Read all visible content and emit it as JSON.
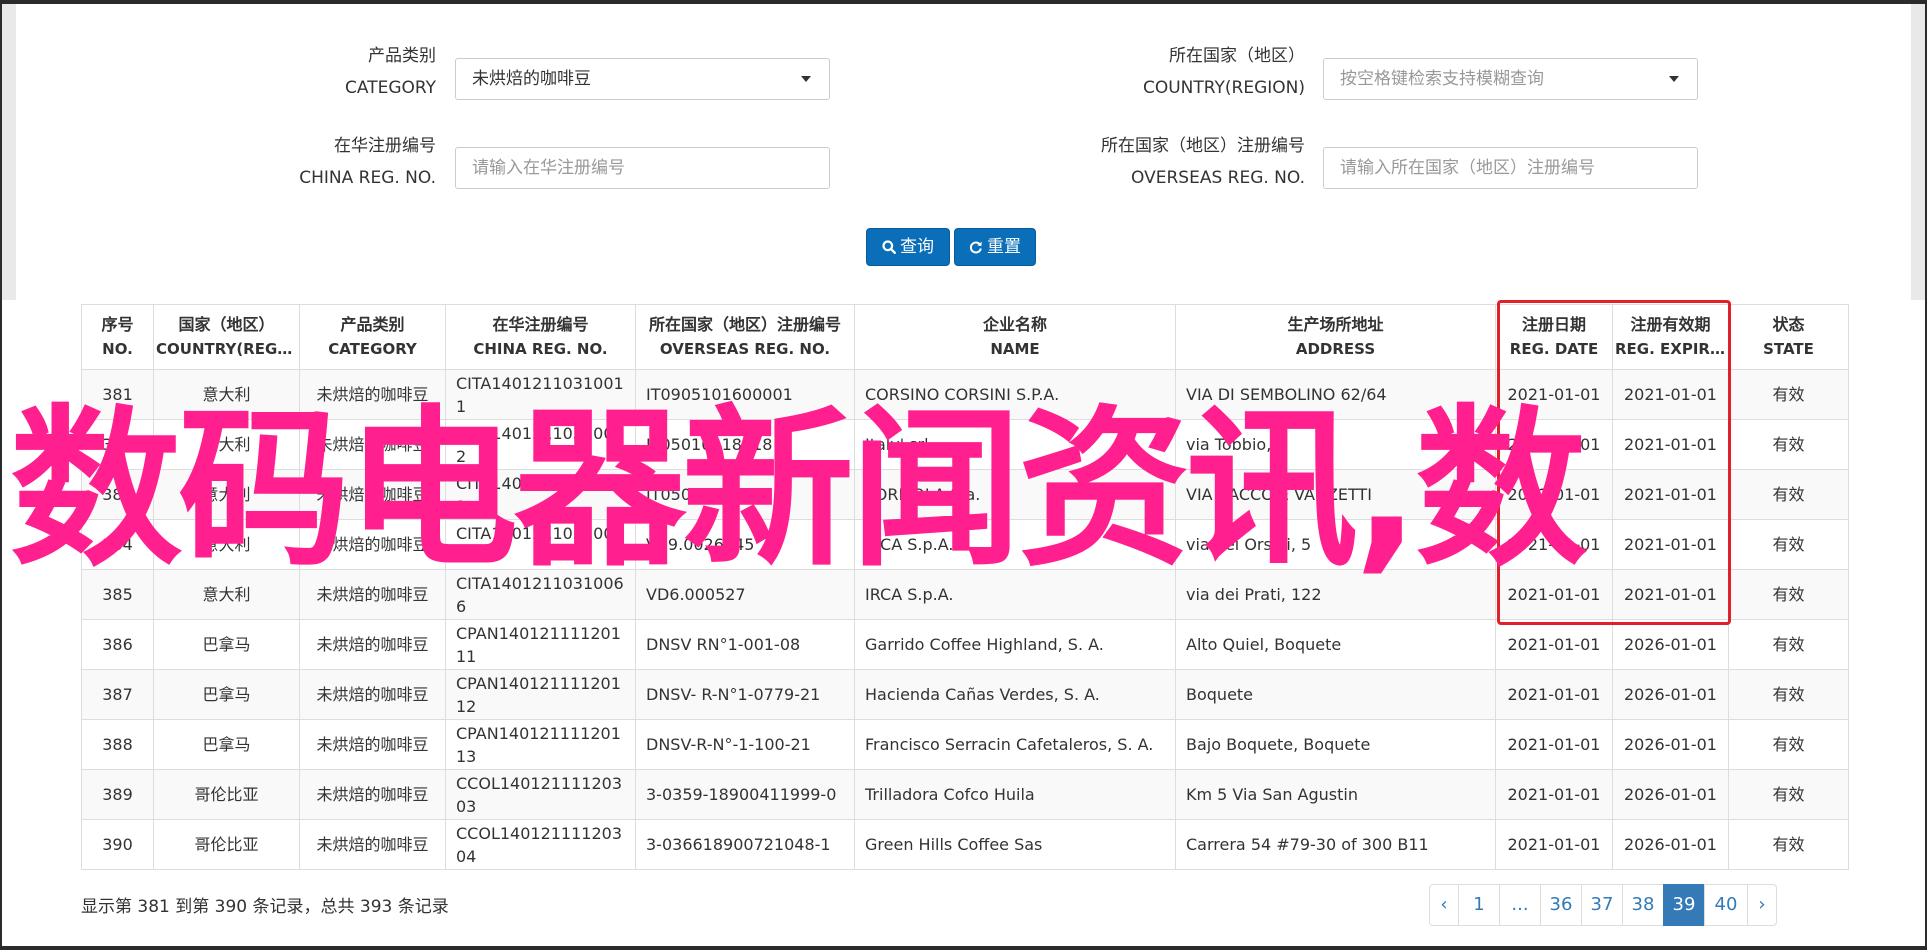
{
  "form": {
    "category_label_cn": "产品类别",
    "category_label_en": "CATEGORY",
    "category_value": "未烘焙的咖啡豆",
    "country_label_cn": "所在国家（地区）",
    "country_label_en": "COUNTRY(REGION)",
    "country_placeholder": "按空格键检索支持模糊查询",
    "china_reg_label_cn": "在华注册编号",
    "china_reg_label_en": "CHINA REG. NO.",
    "china_reg_placeholder": "请输入在华注册编号",
    "overseas_reg_label_cn": "所在国家（地区）注册编号",
    "overseas_reg_label_en": "OVERSEAS REG. NO.",
    "overseas_reg_placeholder": "请输入所在国家（地区）注册编号",
    "search_button": "查询",
    "reset_button": "重置"
  },
  "table": {
    "headers": [
      {
        "cn": "序号",
        "en": "NO."
      },
      {
        "cn": "国家（地区）",
        "en": "COUNTRY(REGIO…"
      },
      {
        "cn": "产品类别",
        "en": "CATEGORY"
      },
      {
        "cn": "在华注册编号",
        "en": "CHINA REG. NO."
      },
      {
        "cn": "所在国家（地区）注册编号",
        "en": "OVERSEAS REG. NO."
      },
      {
        "cn": "企业名称",
        "en": "NAME"
      },
      {
        "cn": "生产场所地址",
        "en": "ADDRESS"
      },
      {
        "cn": "注册日期",
        "en": "REG. DATE"
      },
      {
        "cn": "注册有效期",
        "en": "REG. EXPIRE …"
      },
      {
        "cn": "状态",
        "en": "STATE"
      }
    ],
    "rows": [
      [
        "381",
        "意大利",
        "未烘焙的咖啡豆",
        "CITA14012110310011",
        "IT0905101600001",
        "CORSINO CORSINI S.P.A.",
        "VIA DI SEMBOLINO 62/64",
        "2021-01-01",
        "2021-01-01",
        "有效"
      ],
      [
        "382",
        "意大利",
        "未烘焙的咖啡豆",
        "CITA14012110310022",
        "IT05010118718",
        "Italy' srl",
        "via Tobbio, 1",
        "2021-01-01",
        "2021-01-01",
        "有效"
      ],
      [
        "383",
        "意大利",
        "未烘焙的咖啡豆",
        "CITA14012110310033",
        "IT05019/2003",
        "TORMOLA S.a.",
        "VIA SACCO E VANZETTI",
        "2021-01-01",
        "2021-01-01",
        "有效"
      ],
      [
        "384",
        "意大利",
        "未烘焙的咖啡豆",
        "CITA14012110310044",
        "VB9.0026945",
        "IRCA S.p.A.",
        "via dei Orsini, 5",
        "2021-01-01",
        "2021-01-01",
        "有效"
      ],
      [
        "385",
        "意大利",
        "未烘焙的咖啡豆",
        "CITA14012110310066",
        "VD6.000527",
        "IRCA S.p.A.",
        "via dei Prati, 122",
        "2021-01-01",
        "2021-01-01",
        "有效"
      ],
      [
        "386",
        "巴拿马",
        "未烘焙的咖啡豆",
        "CPAN14012111120111",
        "DNSV RN°1-001-08",
        "Garrido Coffee Highland, S. A.",
        "Alto Quiel, Boquete",
        "2021-01-01",
        "2026-01-01",
        "有效"
      ],
      [
        "387",
        "巴拿马",
        "未烘焙的咖啡豆",
        "CPAN14012111120112",
        "DNSV- R-N°1-0779-21",
        "Hacienda Cañas Verdes, S. A.",
        "Boquete",
        "2021-01-01",
        "2026-01-01",
        "有效"
      ],
      [
        "388",
        "巴拿马",
        "未烘焙的咖啡豆",
        "CPAN14012111120113",
        "DNSV-R-N°-1-100-21",
        "Francisco Serracin Cafetaleros, S. A.",
        "Bajo Boquete, Boquete",
        "2021-01-01",
        "2026-01-01",
        "有效"
      ],
      [
        "389",
        "哥伦比亚",
        "未烘焙的咖啡豆",
        "CCOL14012111120303",
        "3-0359-18900411999-0",
        "Trilladora Cofco Huila",
        "Km 5 Via San Agustin",
        "2021-01-01",
        "2026-01-01",
        "有效"
      ],
      [
        "390",
        "哥伦比亚",
        "未烘焙的咖啡豆",
        "CCOL14012111120304",
        "3-036618900721048-1",
        "Green Hills Coffee Sas",
        "Carrera 54 #79-30 of 300 B11",
        "2021-01-01",
        "2026-01-01",
        "有效"
      ]
    ]
  },
  "footer": {
    "summary": "显示第 381 到第 390 条记录，总共 393 条记录",
    "pages": [
      "‹",
      "1",
      "...",
      "36",
      "37",
      "38",
      "39",
      "40",
      "›"
    ],
    "active_page": "39"
  },
  "overlay_text": "数码电器新闻资讯,数",
  "colors": {
    "primary": "#0b6eb8",
    "pagination_active": "#337ab7",
    "highlight_border": "#e0202a",
    "overlay": "#ff1f8e"
  }
}
